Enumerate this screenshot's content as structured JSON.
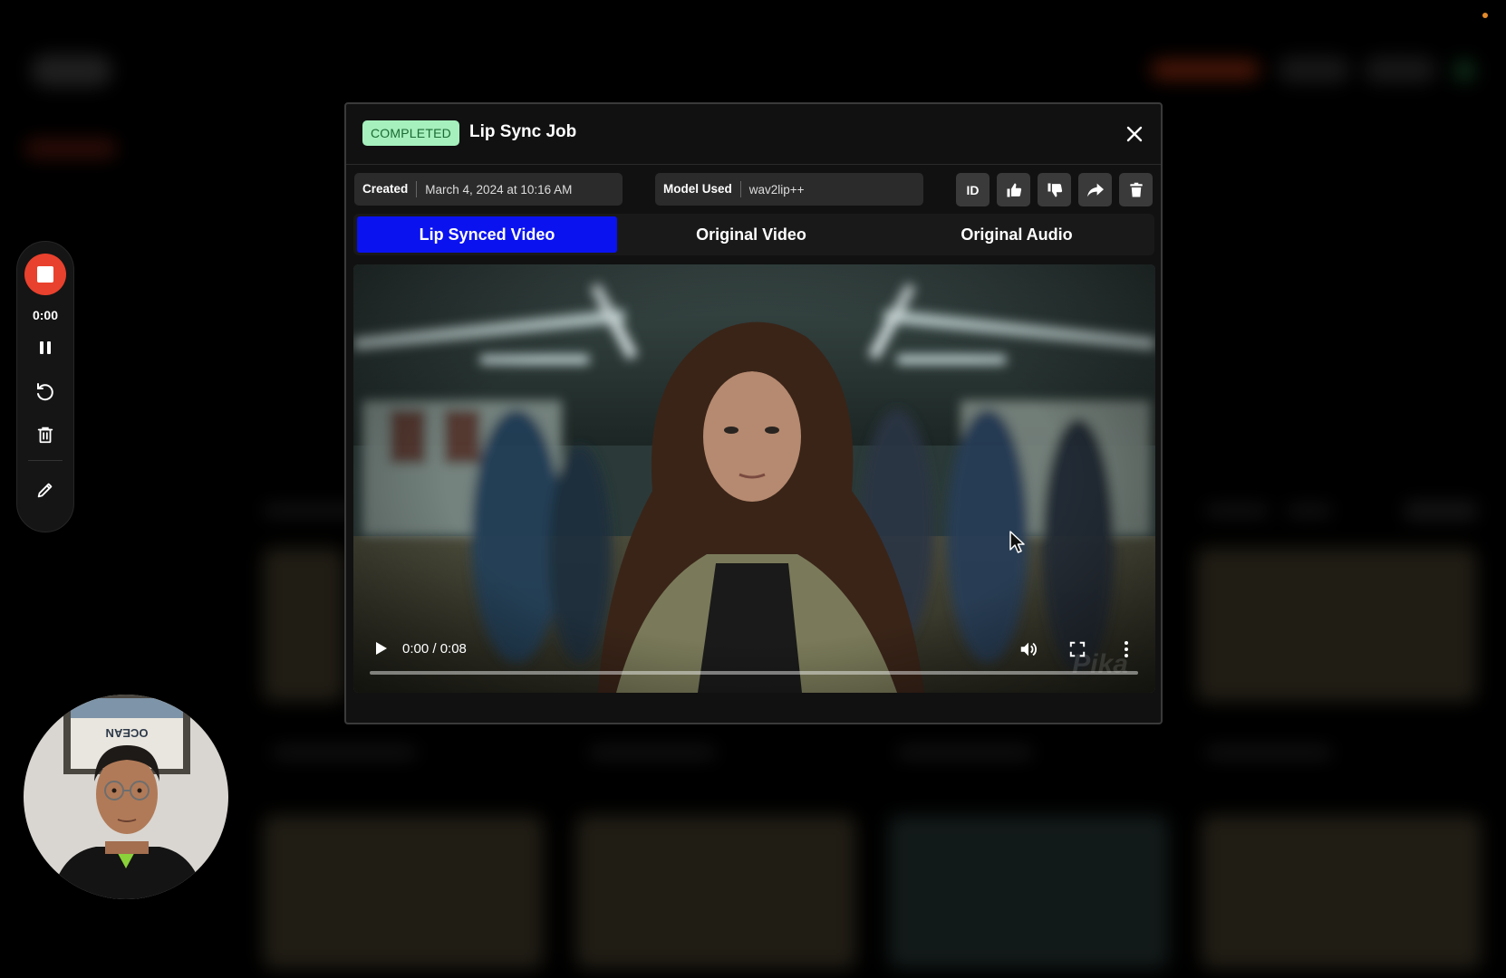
{
  "modal": {
    "status": "COMPLETED",
    "title": "Lip Sync Job",
    "created_label": "Created",
    "created_value": "March 4, 2024 at 10:16 AM",
    "model_label": "Model Used",
    "model_value": "wav2lip++",
    "id_button_label": "ID",
    "tabs": [
      {
        "label": "Lip Synced Video",
        "active": true
      },
      {
        "label": "Original Video",
        "active": false
      },
      {
        "label": "Original Audio",
        "active": false
      }
    ]
  },
  "player": {
    "time": "0:00 / 0:08",
    "progress": 0
  },
  "recorder": {
    "elapsed": "0:00"
  },
  "watermark": "Pika",
  "webcam": {
    "frame_text": "OCEAN"
  },
  "colors": {
    "accent": "#0a12f0",
    "status_bg": "#a6f0bd",
    "record": "#e8412d"
  },
  "icons": [
    "close-icon",
    "thumbs-up-icon",
    "thumbs-down-icon",
    "share-icon",
    "trash-icon",
    "play-icon",
    "volume-icon",
    "fullscreen-icon",
    "more-vertical-icon",
    "stop-icon",
    "pause-icon",
    "restart-icon",
    "draw-icon"
  ]
}
